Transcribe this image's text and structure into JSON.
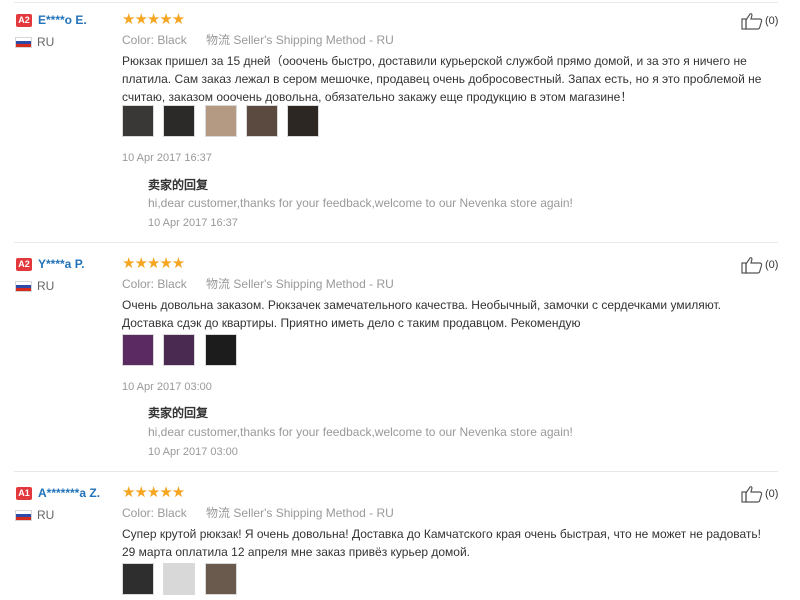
{
  "labels": {
    "color": "Color:",
    "shipping": "物流",
    "seller_reply": "卖家的回复"
  },
  "colors": {
    "stars": "#f5a623",
    "badge": "#e4393c",
    "name": "#2273b9"
  },
  "reviews": [
    {
      "level": "A2",
      "name": "E****o E.",
      "country": "RU",
      "rating": 5,
      "color": "Black",
      "shipping": "Seller's Shipping Method - RU",
      "text": "Рюкзак пришел за 15 дней（ооочень быстро, доставили курьерской службой прямо домой, и за это я ничего не платила. Сам заказ лежал в сером мешочке, продавец очень добросовестный. Запах есть, но я это проблемой не считаю, заказом ооочень довольна, обязательно закажу еще продукцию в этом магазине！",
      "photos": [
        "#3a3836",
        "#2c2a29",
        "#b49a82",
        "#5a4a40",
        "#2d2724"
      ],
      "date": "10 Apr 2017 16:37",
      "reply": "hi,dear customer,thanks for your feedback,welcome to our Nevenka store again!",
      "reply_date": "10 Apr 2017 16:37",
      "likes": "(0)"
    },
    {
      "level": "A2",
      "name": "Y****a P.",
      "country": "RU",
      "rating": 5,
      "color": "Black",
      "shipping": "Seller's Shipping Method - RU",
      "text": "Очень довольна заказом. Рюкзачек замечательного качества. Необычный, замочки с сердечками умиляют. Доставка сдэк до квартиры. Приятно иметь дело с таким продавцом. Рекомендую",
      "photos": [
        "#5b2a63",
        "#4a2a50",
        "#1c1c1c"
      ],
      "date": "10 Apr 2017 03:00",
      "reply": "hi,dear customer,thanks for your feedback,welcome to our Nevenka store again!",
      "reply_date": "10 Apr 2017 03:00",
      "likes": "(0)"
    },
    {
      "level": "A1",
      "name": "A*******a Z.",
      "country": "RU",
      "rating": 5,
      "color": "Black",
      "shipping": "Seller's Shipping Method - RU",
      "text": "Супер крутой рюкзак! Я очень довольна! Доставка до Камчатского края очень быстрая, что не может не радовать! 29 марта оплатила 12 апреля мне заказ привёз курьер домой.",
      "photos": [
        "#2e2e2e",
        "#d8d8d8",
        "#6a5a4e"
      ],
      "likes": "(0)"
    }
  ]
}
